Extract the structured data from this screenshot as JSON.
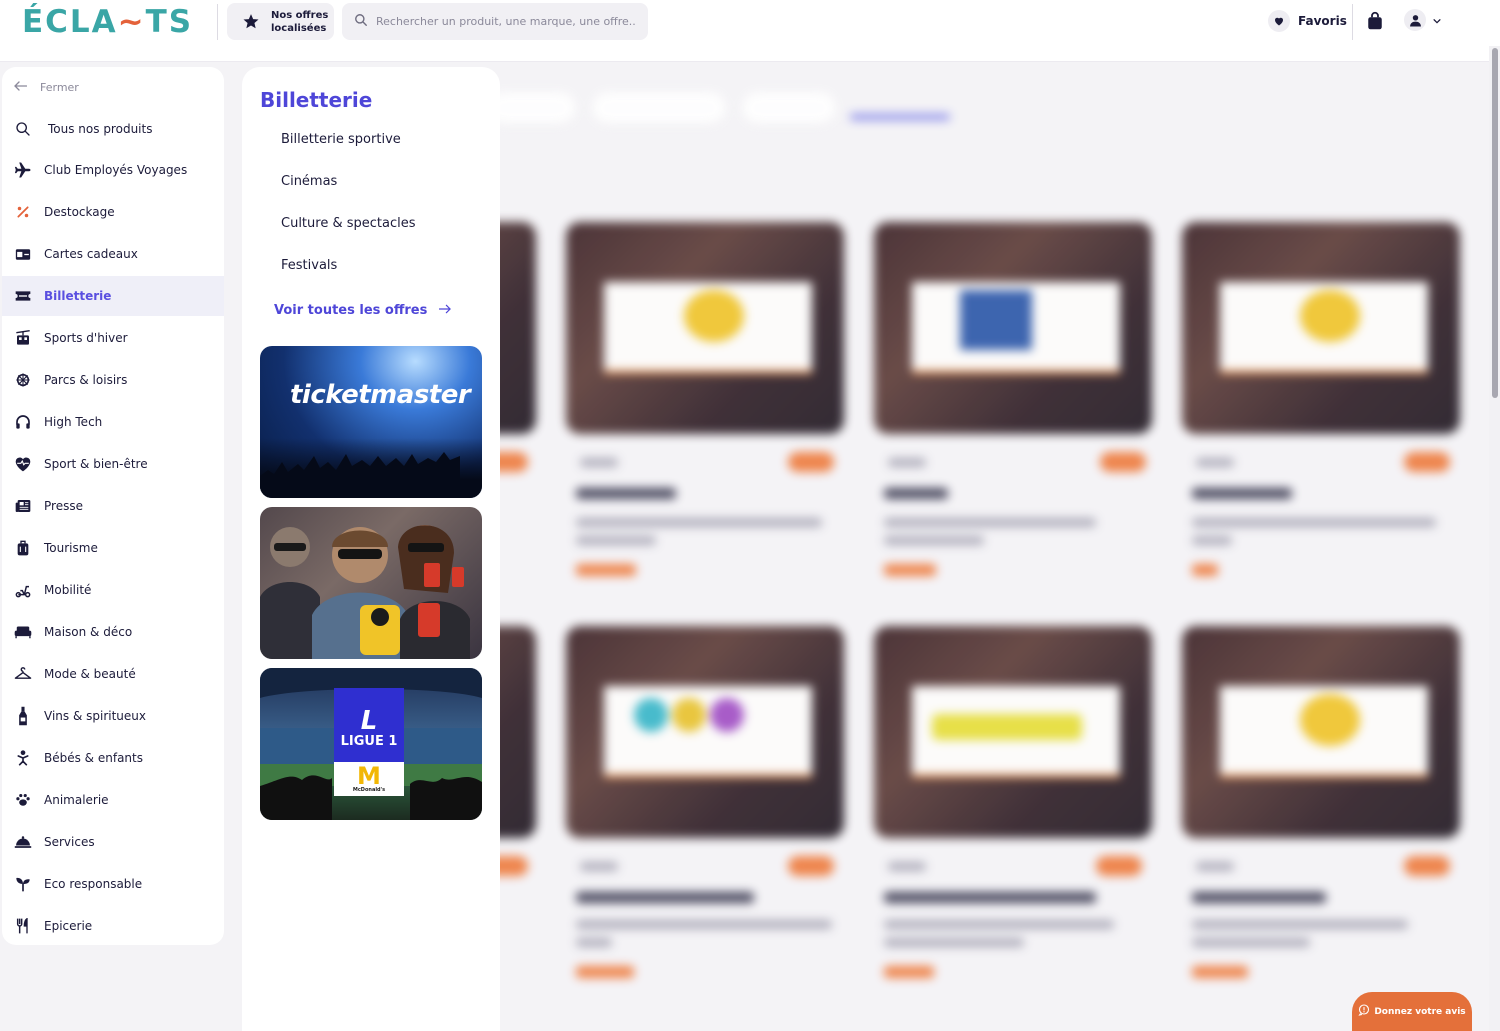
{
  "header": {
    "logo_part1": "ÉCLA",
    "logo_sep": "~",
    "logo_part2": "TS",
    "offers_line1": "Nos offres",
    "offers_line2": "localisées",
    "search_placeholder": "Rechercher un produit, une marque, une offre..",
    "favorites_label": "Favoris"
  },
  "sidebar": {
    "close_label": "Fermer",
    "items": [
      {
        "label": "Tous nos produits",
        "icon": "search-icon"
      },
      {
        "label": "Club Employés Voyages",
        "icon": "plane-icon"
      },
      {
        "label": "Destockage",
        "icon": "percent-icon"
      },
      {
        "label": "Cartes cadeaux",
        "icon": "gift-card-icon"
      },
      {
        "label": "Billetterie",
        "icon": "ticket-icon",
        "active": true
      },
      {
        "label": "Sports d'hiver",
        "icon": "cable-car-icon"
      },
      {
        "label": "Parcs & loisirs",
        "icon": "ferris-wheel-icon"
      },
      {
        "label": "High Tech",
        "icon": "headphones-icon"
      },
      {
        "label": "Sport & bien-être",
        "icon": "heart-pulse-icon"
      },
      {
        "label": "Presse",
        "icon": "newspaper-icon"
      },
      {
        "label": "Tourisme",
        "icon": "luggage-icon"
      },
      {
        "label": "Mobilité",
        "icon": "scooter-icon"
      },
      {
        "label": "Maison & déco",
        "icon": "sofa-icon"
      },
      {
        "label": "Mode & beauté",
        "icon": "hanger-icon"
      },
      {
        "label": "Vins & spiritueux",
        "icon": "bottle-icon"
      },
      {
        "label": "Bébés & enfants",
        "icon": "baby-icon"
      },
      {
        "label": "Animalerie",
        "icon": "paw-icon"
      },
      {
        "label": "Services",
        "icon": "bell-icon"
      },
      {
        "label": "Eco responsable",
        "icon": "sprout-icon"
      },
      {
        "label": "Epicerie",
        "icon": "cutlery-icon"
      }
    ]
  },
  "category_panel": {
    "title": "Billetterie",
    "subcategories": [
      "Billetterie sportive",
      "Cinémas",
      "Culture & spectacles",
      "Festivals"
    ],
    "see_all_label": "Voir toutes les offres",
    "promos": [
      {
        "name": "ticketmaster",
        "text": "ticketmaster"
      },
      {
        "name": "cinema"
      },
      {
        "name": "ligue1",
        "line1": "L",
        "line2": "LIGUE 1",
        "sponsor": "M",
        "sponsor_text": "McDonald's"
      }
    ]
  },
  "feedback_label": "Donnez votre avis",
  "colors": {
    "accent": "#4e46d8",
    "brand_teal": "#3aa6a6",
    "brand_orange": "#e4623a",
    "badge_orange": "#ee7a3b"
  }
}
